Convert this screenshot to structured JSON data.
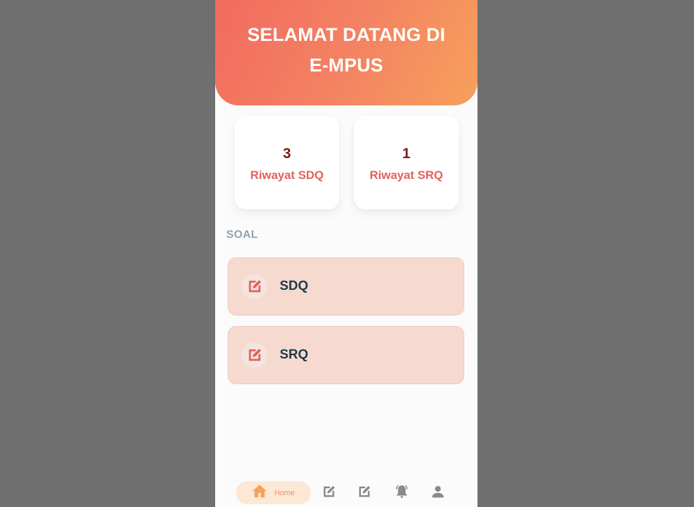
{
  "header": {
    "title_line1": "SELAMAT DATANG DI",
    "title_line2": "E-MPUS"
  },
  "stats": [
    {
      "count": "3",
      "label": "Riwayat SDQ"
    },
    {
      "count": "1",
      "label": "Riwayat SRQ"
    }
  ],
  "section": {
    "title": "SOAL"
  },
  "soal_items": [
    {
      "label": "SDQ",
      "icon": "edit-document-icon"
    },
    {
      "label": "SRQ",
      "icon": "edit-document-icon"
    }
  ],
  "bottom_nav": {
    "home_label": "Home",
    "items": [
      "home-icon",
      "sdq-nav-icon",
      "srq-nav-icon",
      "notification-bell-icon",
      "profile-icon"
    ],
    "active_color": "#f3a35b",
    "inactive_color": "#8a8a8a"
  },
  "colors": {
    "header_gradient_start": "#f26b5f",
    "header_gradient_end": "#f7a05c",
    "accent_red": "#e4605a",
    "card_peach": "#f6dacf"
  }
}
